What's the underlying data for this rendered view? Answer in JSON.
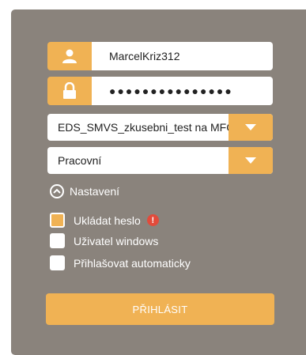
{
  "login": {
    "username_value": "MarcelKriz312",
    "password_value": "●●●●●●●●●●●●●●●",
    "server_selected": "EDS_SMVS_zkusebni_test na MFC",
    "profile_selected": "Pracovní",
    "settings_label": "Nastavení",
    "remember_password_label": "Ukládat heslo",
    "remember_password_checked": true,
    "windows_user_label": "Uživatel windows",
    "windows_user_checked": false,
    "auto_login_label": "Přihlašovat automaticky",
    "auto_login_checked": false,
    "warning_glyph": "!",
    "submit_label": "PŘIHLÁSIT"
  },
  "icons": {
    "user": "user-icon",
    "lock": "lock-icon",
    "dropdown": "chevron-down-icon",
    "settings_toggle": "chevron-up-circle-icon",
    "warning": "warning-icon"
  },
  "colors": {
    "panel": "#8a837c",
    "accent": "#f0b254",
    "warning": "#e24b3b",
    "text_light": "#ffffff"
  }
}
